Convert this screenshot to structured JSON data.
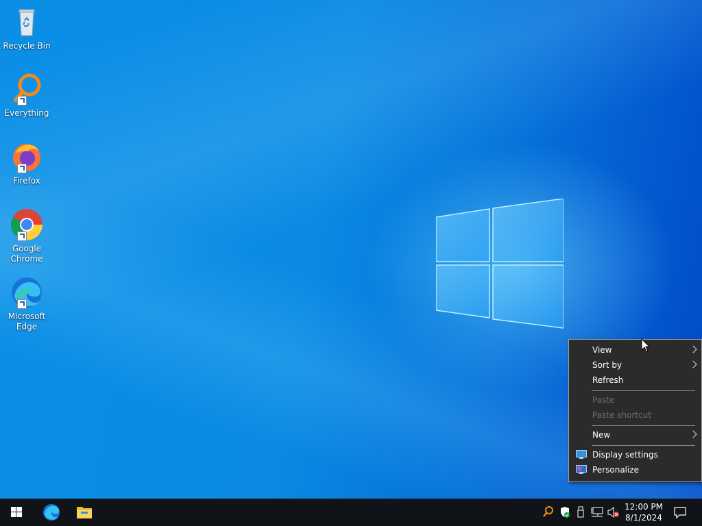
{
  "desktop": {
    "icons": [
      {
        "label": "Recycle Bin",
        "icon": "recycle-bin-icon"
      },
      {
        "label": "Everything",
        "icon": "everything-search-icon"
      },
      {
        "label": "Firefox",
        "icon": "firefox-icon"
      },
      {
        "label": "Google Chrome",
        "icon": "chrome-icon"
      },
      {
        "label": "Microsoft Edge",
        "icon": "edge-icon"
      }
    ]
  },
  "context_menu": {
    "items": [
      {
        "label": "View",
        "submenu": true,
        "enabled": true
      },
      {
        "label": "Sort by",
        "submenu": true,
        "enabled": true
      },
      {
        "label": "Refresh",
        "submenu": false,
        "enabled": true
      },
      {
        "label": "Paste",
        "submenu": false,
        "enabled": false
      },
      {
        "label": "Paste shortcut",
        "submenu": false,
        "enabled": false
      },
      {
        "label": "New",
        "submenu": true,
        "enabled": true
      },
      {
        "label": "Display settings",
        "submenu": false,
        "enabled": true,
        "icon": "display-settings-icon"
      },
      {
        "label": "Personalize",
        "submenu": false,
        "enabled": true,
        "icon": "personalize-icon"
      }
    ]
  },
  "taskbar": {
    "pinned": [
      "start-icon",
      "edge-icon",
      "file-explorer-icon"
    ],
    "tray_icons": [
      "everything-tray-icon",
      "windows-security-icon",
      "usb-icon",
      "network-icon",
      "volume-muted-icon"
    ],
    "clock": {
      "time": "12:00 PM",
      "date": "8/1/2024"
    }
  },
  "colors": {
    "desktop_blue": "#0a8ae3",
    "menu_bg": "#2b2b2b",
    "taskbar_bg": "#101418"
  }
}
